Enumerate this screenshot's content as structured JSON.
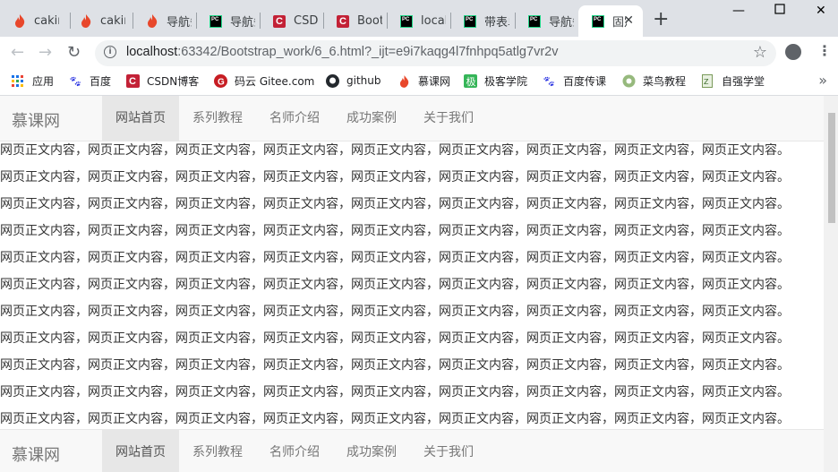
{
  "browser": {
    "tabs": [
      {
        "icon": "flame-icon",
        "title": "caking"
      },
      {
        "icon": "flame-icon",
        "title": "caking"
      },
      {
        "icon": "flame-icon",
        "title": "导航条"
      },
      {
        "icon": "pycharm-icon",
        "title": "导航条"
      },
      {
        "icon": "csdn-icon",
        "title": "CSDN"
      },
      {
        "icon": "csdn-icon",
        "title": "Bootstrap"
      },
      {
        "icon": "pycharm-icon",
        "title": "localhost"
      },
      {
        "icon": "pycharm-icon",
        "title": "带表单"
      },
      {
        "icon": "pycharm-icon",
        "title": "导航条"
      },
      {
        "icon": "pycharm-icon",
        "title": "固定",
        "active": true
      }
    ],
    "new_tab": "+",
    "url_host": "localhost",
    "url_rest": ":63342/Bootstrap_work/6_6.html?_ijt=e9i7kaqg4l7fnhpq5atlg7vr2v"
  },
  "bookmarks": [
    {
      "icon": "apps-grid-icon",
      "label": "应用"
    },
    {
      "icon": "baidu-paw-icon",
      "label": "百度"
    },
    {
      "icon": "csdn-icon",
      "label": "CSDN博客"
    },
    {
      "icon": "gitee-icon",
      "label": "码云 Gitee.com"
    },
    {
      "icon": "github-icon",
      "label": "github"
    },
    {
      "icon": "flame-icon",
      "label": "慕课网"
    },
    {
      "icon": "jikexueyuan-icon",
      "label": "极客学院"
    },
    {
      "icon": "baidu-paw-icon",
      "label": "百度传课"
    },
    {
      "icon": "runoob-icon",
      "label": "菜鸟教程"
    },
    {
      "icon": "page-icon",
      "label": "自强学堂"
    }
  ],
  "page": {
    "brand": "慕课网",
    "nav": [
      "网站首页",
      "系列教程",
      "名师介绍",
      "成功案例",
      "关于我们"
    ],
    "active_nav": "网站首页",
    "body_line": "网页正文内容，网页正文内容，网页正文内容，网页正文内容，网页正文内容，网页正文内容，网页正文内容，网页正文内容，网页正文内容。"
  },
  "colors": {
    "tabstrip": "#dee1e6",
    "navbar_bg": "#f8f8f8",
    "navbar_active": "#e7e7e7",
    "csdn_red": "#c32136",
    "pycharm_green": "#21d789",
    "flame_red": "#e8472b"
  }
}
